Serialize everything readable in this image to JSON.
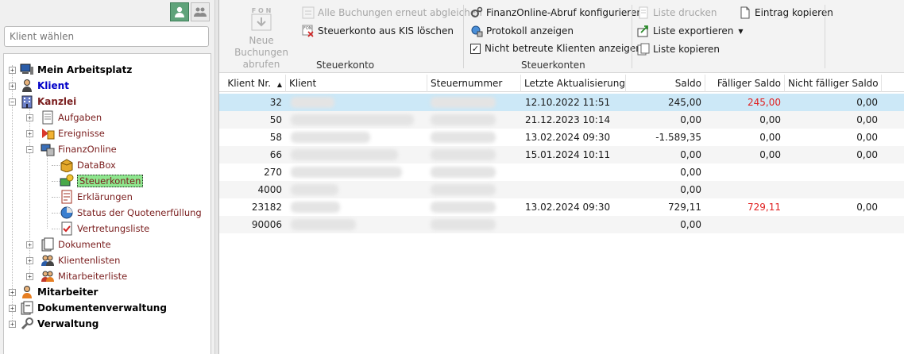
{
  "left_panel": {
    "search": {
      "placeholder": "Klient wählen",
      "value": ""
    },
    "tree": {
      "mein_arbeitsplatz": "Mein Arbeitsplatz",
      "klient": "Klient",
      "kanzlei": "Kanzlei",
      "aufgaben": "Aufgaben",
      "ereignisse": "Ereignisse",
      "finanzonline": "FinanzOnline",
      "databox": "DataBox",
      "steuerkonten": "Steuerkonten",
      "erklaerungen": "Erklärungen",
      "status_quote": "Status der Quotenerfüllung",
      "vertretungsliste": "Vertretungsliste",
      "dokumente": "Dokumente",
      "klientenlisten": "Klientenlisten",
      "mitarbeiterliste": "Mitarbeiterliste",
      "mitarbeiter": "Mitarbeiter",
      "dokumentenverwaltung": "Dokumentenverwaltung",
      "verwaltung": "Verwaltung"
    }
  },
  "ribbon": {
    "neue_buchungen_line1": "Neue Buchungen",
    "neue_buchungen_line2": "abrufen",
    "fon_icon_text": "F O N",
    "alle_buchungen": "Alle Buchungen erneut abgleichen",
    "steuerkonto_loeschen": "Steuerkonto aus KIS löschen",
    "group1_label": "Steuerkonto",
    "abruf_konfigurieren": "FinanzOnline-Abruf konfigurieren",
    "protokoll": "Protokoll anzeigen",
    "nicht_betreute": "Nicht betreute Klienten anzeigen",
    "nicht_betreute_checked": true,
    "group2_label": "Steuerkonten",
    "liste_drucken": "Liste drucken",
    "liste_exportieren": "Liste exportieren",
    "liste_kopieren": "Liste kopieren",
    "eintrag_kopieren": "Eintrag kopieren"
  },
  "grid": {
    "columns": {
      "klient_nr": "Klient Nr.",
      "klient": "Klient",
      "steuernummer": "Steuernummer",
      "letzte_aktualisierung": "Letzte Aktualisierung",
      "saldo": "Saldo",
      "faelliger_saldo": "Fälliger Saldo",
      "nicht_faelliger_saldo": "Nicht fälliger Saldo"
    },
    "rows": [
      {
        "nr": "32",
        "date": "12.10.2022 11:51",
        "saldo": "245,00",
        "faellig": "245,00",
        "nicht_faellig": "0,00"
      },
      {
        "nr": "50",
        "date": "21.12.2023 10:14",
        "saldo": "0,00",
        "faellig": "0,00",
        "nicht_faellig": "0,00"
      },
      {
        "nr": "58",
        "date": "13.02.2024 09:30",
        "saldo": "-1.589,35",
        "faellig": "0,00",
        "nicht_faellig": "0,00"
      },
      {
        "nr": "66",
        "date": "15.01.2024 10:11",
        "saldo": "0,00",
        "faellig": "0,00",
        "nicht_faellig": "0,00"
      },
      {
        "nr": "270",
        "date": "",
        "saldo": "0,00",
        "faellig": "",
        "nicht_faellig": ""
      },
      {
        "nr": "4000",
        "date": "",
        "saldo": "0,00",
        "faellig": "",
        "nicht_faellig": ""
      },
      {
        "nr": "23182",
        "date": "13.02.2024 09:30",
        "saldo": "729,11",
        "faellig": "729,11",
        "nicht_faellig": "0,00"
      },
      {
        "nr": "90006",
        "date": "",
        "saldo": "0,00",
        "faellig": "",
        "nicht_faellig": ""
      }
    ]
  },
  "colors": {
    "selected_row": "#cce8f7",
    "overdue_red": "#e02020",
    "selected_tree_item": "#8ee68e"
  }
}
